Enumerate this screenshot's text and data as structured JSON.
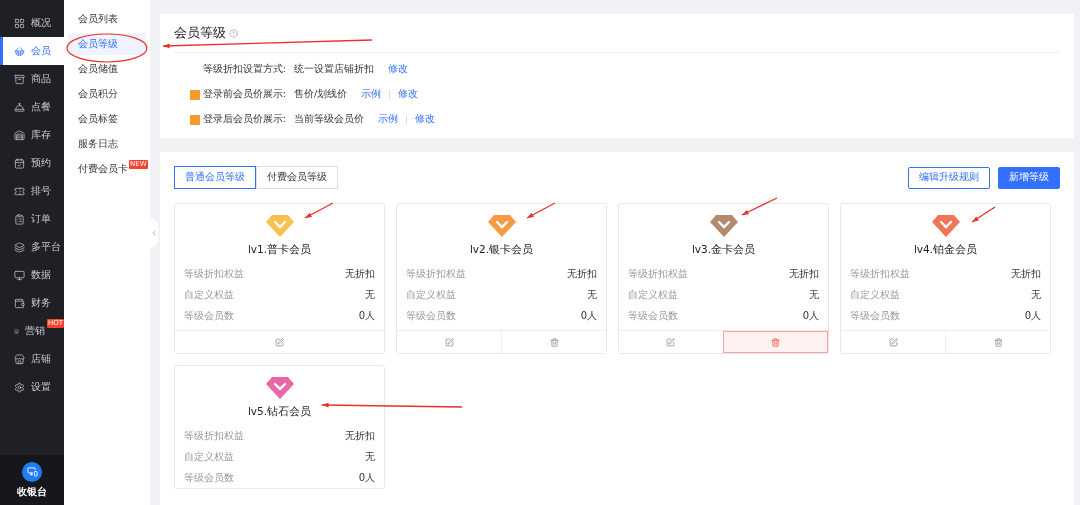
{
  "sidebar": {
    "items": [
      {
        "label": "概况",
        "selected": false
      },
      {
        "label": "会员",
        "selected": true
      },
      {
        "label": "商品",
        "selected": false
      },
      {
        "label": "点餐",
        "selected": false
      },
      {
        "label": "库存",
        "selected": false
      },
      {
        "label": "预约",
        "selected": false
      },
      {
        "label": "排号",
        "selected": false
      },
      {
        "label": "订单",
        "selected": false
      },
      {
        "label": "多平台",
        "selected": false
      },
      {
        "label": "数据",
        "selected": false
      },
      {
        "label": "财务",
        "selected": false
      },
      {
        "label": "营销",
        "selected": false,
        "badge": "HOT"
      },
      {
        "label": "店铺",
        "selected": false
      },
      {
        "label": "设置",
        "selected": false
      }
    ],
    "footer": "收银台"
  },
  "submenu": {
    "items": [
      {
        "label": "会员列表",
        "selected": false
      },
      {
        "label": "会员等级",
        "selected": true
      },
      {
        "label": "会员储值",
        "selected": false
      },
      {
        "label": "会员积分",
        "selected": false
      },
      {
        "label": "会员标签",
        "selected": false
      },
      {
        "label": "服务日志",
        "selected": false
      },
      {
        "label": "付费会员卡",
        "selected": false,
        "badge": "NEW"
      }
    ]
  },
  "settings": {
    "title": "会员等级",
    "rows": [
      {
        "label": "等级折扣设置方式:",
        "value": "统一设置店铺折扣",
        "icon": false,
        "links": [
          "修改"
        ]
      },
      {
        "label": "登录前会员价展示:",
        "value": "售价/划线价",
        "icon": true,
        "links": [
          "示例",
          "修改"
        ]
      },
      {
        "label": "登录后会员价展示:",
        "value": "当前等级会员价",
        "icon": true,
        "links": [
          "示例",
          "修改"
        ]
      }
    ]
  },
  "levels": {
    "tabs": [
      {
        "label": "普通会员等级",
        "selected": true
      },
      {
        "label": "付费会员等级",
        "selected": false
      }
    ],
    "buttons": [
      {
        "label": "编辑升级规则",
        "kind": "outline"
      },
      {
        "label": "新增等级",
        "kind": "primary"
      }
    ],
    "cards": [
      {
        "name": "lv1.普卡会员",
        "color": "#f7c04f",
        "rows": [
          {
            "label": "等级折扣权益",
            "value": "无折扣"
          },
          {
            "label": "自定义权益",
            "value": "无"
          },
          {
            "label": "等级会员数",
            "value": "0人"
          }
        ],
        "actions": [
          {
            "kind": "edit",
            "highlighted": false
          }
        ]
      },
      {
        "name": "lv2.银卡会员",
        "color": "#f59b45",
        "rows": [
          {
            "label": "等级折扣权益",
            "value": "无折扣"
          },
          {
            "label": "自定义权益",
            "value": "无"
          },
          {
            "label": "等级会员数",
            "value": "0人"
          }
        ],
        "actions": [
          {
            "kind": "edit",
            "highlighted": false
          },
          {
            "kind": "delete",
            "highlighted": false
          }
        ]
      },
      {
        "name": "lv3.金卡会员",
        "color": "#b48a6c",
        "rows": [
          {
            "label": "等级折扣权益",
            "value": "无折扣"
          },
          {
            "label": "自定义权益",
            "value": "无"
          },
          {
            "label": "等级会员数",
            "value": "0人"
          }
        ],
        "actions": [
          {
            "kind": "edit",
            "highlighted": false
          },
          {
            "kind": "delete",
            "highlighted": true
          }
        ]
      },
      {
        "name": "lv4.铂金会员",
        "color": "#ef7659",
        "rows": [
          {
            "label": "等级折扣权益",
            "value": "无折扣"
          },
          {
            "label": "自定义权益",
            "value": "无"
          },
          {
            "label": "等级会员数",
            "value": "0人"
          }
        ],
        "actions": [
          {
            "kind": "edit",
            "highlighted": false
          },
          {
            "kind": "delete",
            "highlighted": false
          }
        ]
      },
      {
        "name": "lv5.钻石会员",
        "color": "#e967a6",
        "rows": [
          {
            "label": "等级折扣权益",
            "value": "无折扣"
          },
          {
            "label": "自定义权益",
            "value": "无"
          },
          {
            "label": "等级会员数",
            "value": "0人"
          }
        ]
      }
    ]
  }
}
